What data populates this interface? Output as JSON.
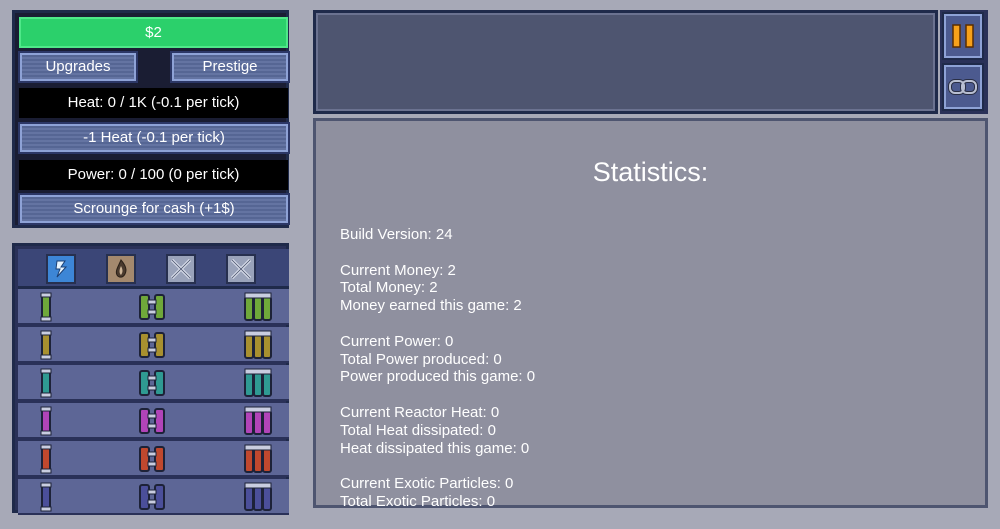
{
  "header": {
    "money": "$2",
    "upgrades_label": "Upgrades",
    "prestige_label": "Prestige",
    "heat_status": "Heat: 0 / 1K (-0.1 per tick)",
    "vent_label": "-1 Heat (-0.1 per tick)",
    "power_status": "Power: 0 / 100 (0 per tick)",
    "scrounge_label": "Scrounge for cash (+1$)"
  },
  "colors": {
    "money_bar": "#2bd06b",
    "button": "#5a6b9c",
    "panel_dark": "#1f2a4a",
    "stats_bg": "#8f909f",
    "pause_icon": "#f7a11a"
  },
  "part_tabs": [
    {
      "icon": "power-tab-icon"
    },
    {
      "icon": "heat-tab-icon"
    },
    {
      "icon": "locked-tab-icon"
    },
    {
      "icon": "locked-tab-icon"
    }
  ],
  "part_rows": [
    {
      "color": "#6fa83a"
    },
    {
      "color": "#a8902f"
    },
    {
      "color": "#2f9a92"
    },
    {
      "color": "#b144b8"
    },
    {
      "color": "#c0482e"
    },
    {
      "color": "#4b4f9a"
    }
  ],
  "controls": {
    "pause_icon": "pause-icon",
    "link_icon": "link-icon"
  },
  "stats": {
    "title": "Statistics:",
    "groups": [
      [
        "Build Version: 24"
      ],
      [
        "Current Money: 2",
        "Total Money: 2",
        "Money earned this game: 2"
      ],
      [
        "Current Power: 0",
        "Total Power produced: 0",
        "Power produced this game: 0"
      ],
      [
        "Current Reactor Heat: 0",
        "Total Heat dissipated: 0",
        "Heat dissipated this game: 0"
      ],
      [
        "Current Exotic Particles: 0",
        "Total Exotic Particles: 0"
      ]
    ]
  }
}
